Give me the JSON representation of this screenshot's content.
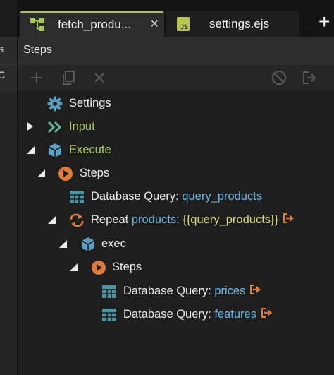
{
  "left_panel": {
    "fragment_1": "s",
    "fragment_2": "C"
  },
  "tabs": [
    {
      "label": "fetch_produ...",
      "icon": "flow-icon",
      "active": true
    },
    {
      "label": "settings.ejs",
      "icon": "js-file-icon",
      "active": false
    }
  ],
  "js_badge": "JS",
  "add_tab": "+",
  "close_glyph": "×",
  "panel": {
    "title": "Steps"
  },
  "toolbar": [
    "add-icon",
    "copy-icon",
    "delete-icon",
    "disable-icon",
    "export-icon"
  ],
  "tree": {
    "settings": {
      "label": "Settings"
    },
    "input": {
      "label": "Input"
    },
    "execute": {
      "label": "Execute"
    },
    "steps": {
      "label": "Steps"
    },
    "db_query_products": {
      "label": "Database Query:",
      "value": "query_products"
    },
    "repeat": {
      "label": "Repeat",
      "value": "products:",
      "expr": "{{query_products}}"
    },
    "exec": {
      "label": "exec"
    },
    "exec_steps": {
      "label": "Steps"
    },
    "db_query_prices": {
      "label": "Database Query:",
      "value": "prices"
    },
    "db_query_features": {
      "label": "Database Query:",
      "value": "features"
    }
  },
  "colors": {
    "accent": "#a7c957",
    "link": "#6fb7e6",
    "expr": "#d9d97a",
    "orange": "#e07b39",
    "teal": "#4e95a3"
  }
}
